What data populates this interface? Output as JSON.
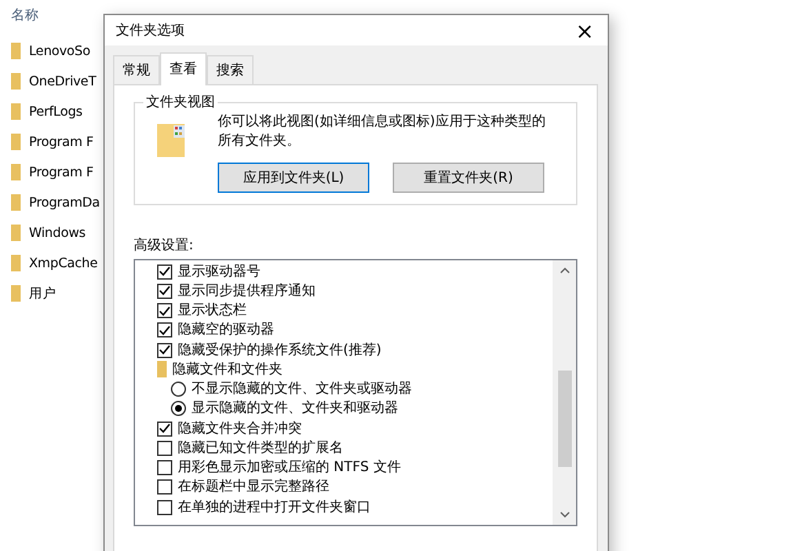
{
  "explorer": {
    "column_header": "名称",
    "items": [
      "LenovoSo",
      "OneDriveT",
      "PerfLogs",
      "Program F",
      "Program F",
      "ProgramDa",
      "Windows",
      "XmpCache",
      "用户"
    ]
  },
  "dialog": {
    "title": "文件夹选项",
    "close": "×",
    "tabs": [
      {
        "label": "常规",
        "selected": false
      },
      {
        "label": "查看",
        "selected": true
      },
      {
        "label": "搜索",
        "selected": false
      }
    ],
    "folder_views": {
      "title": "文件夹视图",
      "description": "你可以将此视图(如详细信息或图标)应用于这种类型的所有文件夹。",
      "buttons": [
        "应用到文件夹(L)",
        "重置文件夹(R)"
      ]
    },
    "advanced": {
      "label": "高级设置:",
      "items": [
        {
          "kind": "checkbox",
          "label": "显示驱动器号",
          "checked": true
        },
        {
          "kind": "checkbox",
          "label": "显示同步提供程序通知",
          "checked": true
        },
        {
          "kind": "checkbox",
          "label": "显示状态栏",
          "checked": true
        },
        {
          "kind": "checkbox",
          "label": "隐藏空的驱动器",
          "checked": true
        },
        {
          "kind": "checkbox",
          "label": "隐藏受保护的操作系统文件(推荐)",
          "checked": true
        },
        {
          "kind": "folder",
          "label": "隐藏文件和文件夹",
          "children": [
            {
              "kind": "radio",
              "label": "不显示隐藏的文件、文件夹或驱动器",
              "selected": false
            },
            {
              "kind": "radio",
              "label": "显示隐藏的文件、文件夹和驱动器",
              "selected": true
            }
          ]
        },
        {
          "kind": "checkbox",
          "label": "隐藏文件夹合并冲突",
          "checked": true
        },
        {
          "kind": "checkbox",
          "label": "隐藏已知文件类型的扩展名",
          "checked": false
        },
        {
          "kind": "checkbox",
          "label": "用彩色显示加密或压缩的 NTFS 文件",
          "checked": false
        },
        {
          "kind": "checkbox",
          "label": "在标题栏中显示完整路径",
          "checked": false
        },
        {
          "kind": "checkbox",
          "label": "在单独的进程中打开文件夹窗口",
          "checked": false
        }
      ]
    }
  }
}
